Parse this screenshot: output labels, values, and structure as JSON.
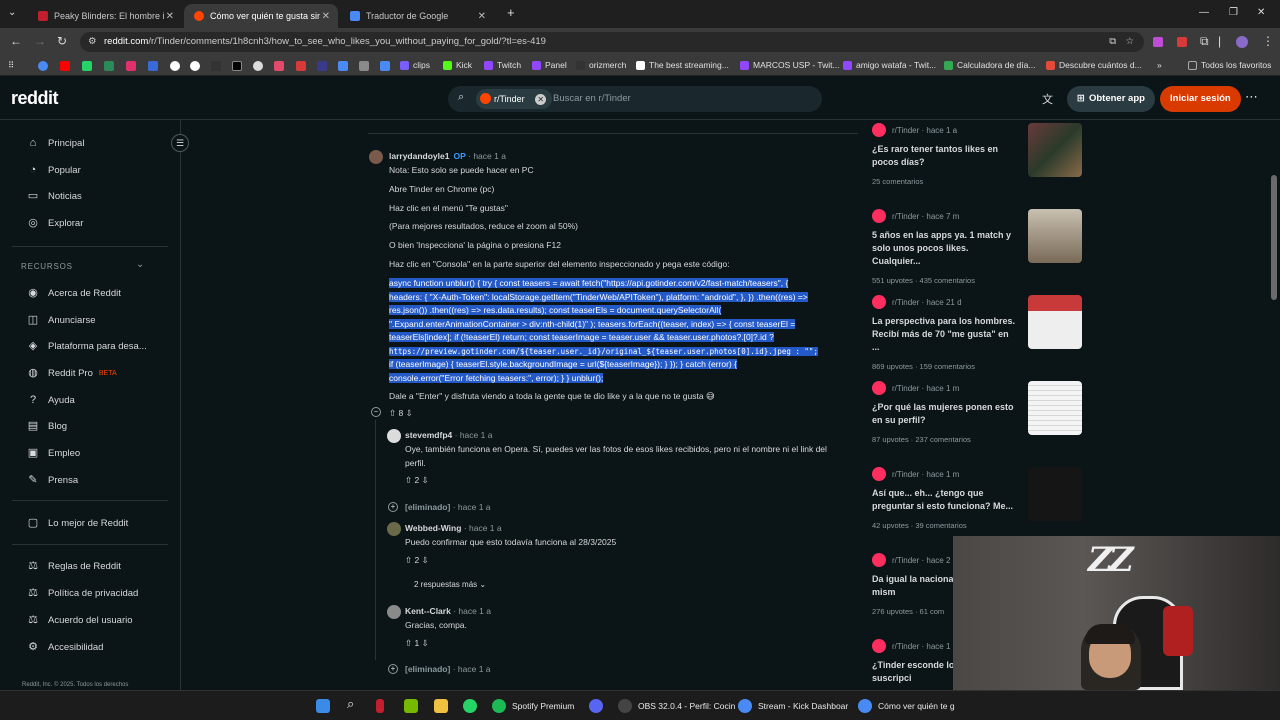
{
  "tabs": [
    {
      "title": "Peaky Blinders: El hombre inmortal",
      "color": "#c41f2f"
    },
    {
      "title": "Cómo ver quién te gusta sin pagar",
      "color": "#ff4500"
    },
    {
      "title": "Traductor de Google",
      "color": "#4a8af4"
    }
  ],
  "address": {
    "domain": "reddit.com",
    "path": "/r/Tinder/comments/1h8cnh3/how_to_see_who_likes_you_without_paying_for_gold/?tl=es-419"
  },
  "bookmarks": [
    {
      "label": "clips",
      "color": "#7b5cff"
    },
    {
      "label": "Kick",
      "color": "#53fc18"
    },
    {
      "label": "Twitch",
      "color": "#9146ff"
    },
    {
      "label": "Panel",
      "color": "#9146ff"
    },
    {
      "label": "orizmerch",
      "color": "#333333"
    },
    {
      "label": "The best streaming...",
      "color": "#ffffff"
    },
    {
      "label": "MARCOS USP - Twit...",
      "color": "#9146ff"
    },
    {
      "label": "amigo watafa - Twit...",
      "color": "#9146ff"
    },
    {
      "label": "Calculadora de día...",
      "color": "#34a853"
    },
    {
      "label": "Descubre cuántos d...",
      "color": "#e34a3a"
    },
    {
      "label": "Todos los favoritos",
      "color": "#aaaaaa"
    }
  ],
  "header": {
    "logo": "reddit",
    "chip": "r/Tinder",
    "search_placeholder": "Buscar en r/Tinder",
    "get_app": "Obtener app",
    "login": "Iniciar sesión"
  },
  "sidebar": {
    "items": [
      {
        "label": "Principal",
        "icon": "home-icon",
        "glyph": "⌂"
      },
      {
        "label": "Popular",
        "icon": "popular-icon",
        "glyph": "◔"
      },
      {
        "label": "Noticias",
        "icon": "news-icon",
        "glyph": "▭"
      },
      {
        "label": "Explorar",
        "icon": "explore-icon",
        "glyph": "◎"
      }
    ],
    "resources_heading": "RECURSOS",
    "resources": [
      {
        "label": "Acerca de Reddit",
        "glyph": "◉"
      },
      {
        "label": "Anunciarse",
        "glyph": "◫"
      },
      {
        "label": "Plataforma para desa...",
        "glyph": "◈"
      },
      {
        "label": "Reddit Pro",
        "glyph": "◍",
        "badge": "BETA"
      },
      {
        "label": "Ayuda",
        "glyph": "?"
      },
      {
        "label": "Blog",
        "glyph": "▤"
      },
      {
        "label": "Empleo",
        "glyph": "▣"
      },
      {
        "label": "Prensa",
        "glyph": "✎"
      }
    ],
    "best_of": "Lo mejor de Reddit",
    "legal": [
      {
        "label": "Reglas de Reddit",
        "glyph": "⚖"
      },
      {
        "label": "Política de privacidad",
        "glyph": "⚖"
      },
      {
        "label": "Acuerdo del usuario",
        "glyph": "⚖"
      },
      {
        "label": "Accesibilidad",
        "glyph": "⚙"
      }
    ],
    "footer": "Reddit, Inc. © 2025. Todos los derechos"
  },
  "op_comment": {
    "author": "larrydandoyle1",
    "op": "OP",
    "time": "· hace 1 a",
    "lines": [
      "Nota: Esto solo se puede hacer en PC",
      "Abre Tinder en Chrome (pc)",
      "Haz clic en el menú \"Te gustas\"",
      "(Para mejores resultados, reduce el zoom al 50%)",
      "O bien 'Inspecciona' la página o presiona F12",
      "Haz clic en \"Consola\" en la parte superior del elemento inspeccionado y pega este código:"
    ],
    "code_lines": [
      "async function unblur() { try { const teasers = await fetch(\"https://api.gotinder.com/v2/fast-match/teasers\", {",
      "headers: { \"X-Auth-Token\": localStorage.getItem(\"TinderWeb/APIToken\"), platform: \"android\", }, }) .then((res) =>",
      "res.json()) .then((res) => res.data.results); const teaserEls = document.querySelectorAll(",
      "\".Expand.enterAnimationContainer > div:nth-child(1)\" ); teasers.forEach((teaser, index) => { const teaserEl =",
      "teaserEls[index]; if (!teaserEl) return; const teaserImage = teaser.user && teaser.user.photos?.[0]?.id ?",
      "https://preview.gotinder.com/${teaser.user._id}/original_${teaser.user.photos[0].id}.jpeg : \"\";",
      "if (teaserImage) { teaserEl.style.backgroundImage = url(${teaserImage}); } }); } catch (error) {",
      "console.error(\"Error fetching teasers:\", error); } } unblur();"
    ],
    "after": "Dale a \"Enter\" y disfruta viendo a toda la gente que te dio like y a la que no te gusta 😅",
    "votes": "8"
  },
  "replies": [
    {
      "author": "stevemdfp4",
      "time": "· hace 1 a",
      "text": "Oye, también funciona en Opera. Sí, puedes ver las fotos de esos likes recibidos, pero ni el nombre ni el link del perfil.",
      "votes": "2"
    },
    {
      "author": "[eliminado]",
      "time": "· hace 1 a"
    },
    {
      "author": "Webbed-Wing",
      "time": "· hace 1 a",
      "text": "Puedo confirmar que esto todavía funciona al 28/3/2025",
      "votes": "2"
    },
    {
      "more": "2 respuestas más"
    },
    {
      "author": "Kent--Clark",
      "time": "· hace 1 a",
      "text": "Gracias, compa.",
      "votes": "1"
    },
    {
      "author": "[eliminado]",
      "time": "· hace 1 a"
    }
  ],
  "related": [
    {
      "sub": "r/Tinder",
      "time": "· hace 1 a",
      "title": "¿Es raro tener tantos likes en pocos días?",
      "stats": "25 comentarios",
      "thumb": "#5a3a3a"
    },
    {
      "sub": "r/Tinder",
      "time": "· hace 7 m",
      "title": "5 años en las apps ya. 1 match y solo unos pocos likes. Cualquier...",
      "stats": "551 upvotes · 435 comentarios",
      "thumb": "#9a8a70"
    },
    {
      "sub": "r/Tinder",
      "time": "· hace 21 d",
      "title": "La perspectiva para los hombres. Recibí más de 70 \"me gusta\" en ...",
      "stats": "869 upvotes · 159 comentarios",
      "thumb": "#e8e8e8"
    },
    {
      "sub": "r/Tinder",
      "time": "· hace 1 m",
      "title": "¿Por qué las mujeres ponen esto en su perfil?",
      "stats": "87 upvotes · 237 comentarios",
      "thumb": "#f4f4f4"
    },
    {
      "sub": "r/Tinder",
      "time": "· hace 1 m",
      "title": "Así que... eh... ¿tengo que preguntar si esto funciona? Me...",
      "stats": "42 upvotes · 39 comentarios",
      "thumb": "#1a1a1a"
    },
    {
      "sub": "r/Tinder",
      "time": "· hace 2",
      "title": "Da igual la naciona siempre es lo mism",
      "stats": "276 upvotes · 61 com",
      "thumb": ""
    },
    {
      "sub": "r/Tinder",
      "time": "· hace 1",
      "title": "¿Tinder esconde los tenés una suscripci",
      "stats": "",
      "thumb": ""
    }
  ],
  "taskbar": [
    {
      "label": "Spotify Premium",
      "color": "#1db954"
    },
    {
      "label": "OBS 32.0.4 - Perfil: Cocin",
      "color": "#444444"
    },
    {
      "label": "Stream - Kick Dashboar",
      "color": "#4a8af4"
    },
    {
      "label": "Cómo ver quién te g",
      "color": "#4a8af4"
    }
  ],
  "webcam_overlay": "ZZ"
}
